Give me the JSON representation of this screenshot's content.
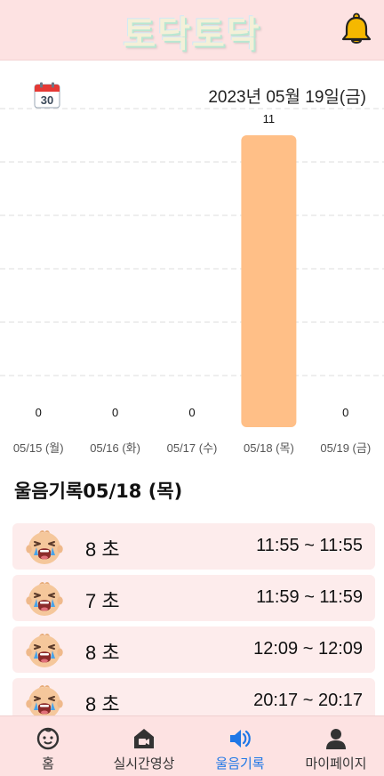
{
  "header": {
    "title": "토닥토닥",
    "bell_icon": "bell-icon"
  },
  "date": {
    "icon": "calendar-icon",
    "calendar_day": "30",
    "text": "2023년 05월 19일(금)"
  },
  "chart_data": {
    "type": "bar",
    "categories": [
      "05/15 (월)",
      "05/16 (화)",
      "05/17 (수)",
      "05/18 (목)",
      "05/19 (금)"
    ],
    "values": [
      0,
      0,
      0,
      11,
      0
    ],
    "data_labels": [
      "0",
      "0",
      "0",
      "11",
      "0"
    ],
    "ylim": [
      0,
      11
    ],
    "grid": true,
    "bar_color": "#ffbf87",
    "grid_color": "#dddddd"
  },
  "section": {
    "title": "울음기록05/18 (목)"
  },
  "cry_records": [
    {
      "duration": "8 초",
      "range": "11:55 ~ 11:55"
    },
    {
      "duration": "7 초",
      "range": "11:59 ~ 11:59"
    },
    {
      "duration": "8 초",
      "range": "12:09 ~ 12:09"
    },
    {
      "duration": "8 초",
      "range": "20:17 ~ 20:17"
    }
  ],
  "nav": {
    "items": [
      {
        "label": "홈",
        "icon": "baby-face-icon",
        "active": false
      },
      {
        "label": "실시간영상",
        "icon": "video-house-icon",
        "active": false
      },
      {
        "label": "울음기록",
        "icon": "speaker-icon",
        "active": true
      },
      {
        "label": "마이페이지",
        "icon": "person-icon",
        "active": false
      }
    ]
  },
  "colors": {
    "header_bg": "#fde2e2",
    "row_bg": "#fdecec",
    "accent": "#1f77e6",
    "bell": "#f5b800"
  }
}
